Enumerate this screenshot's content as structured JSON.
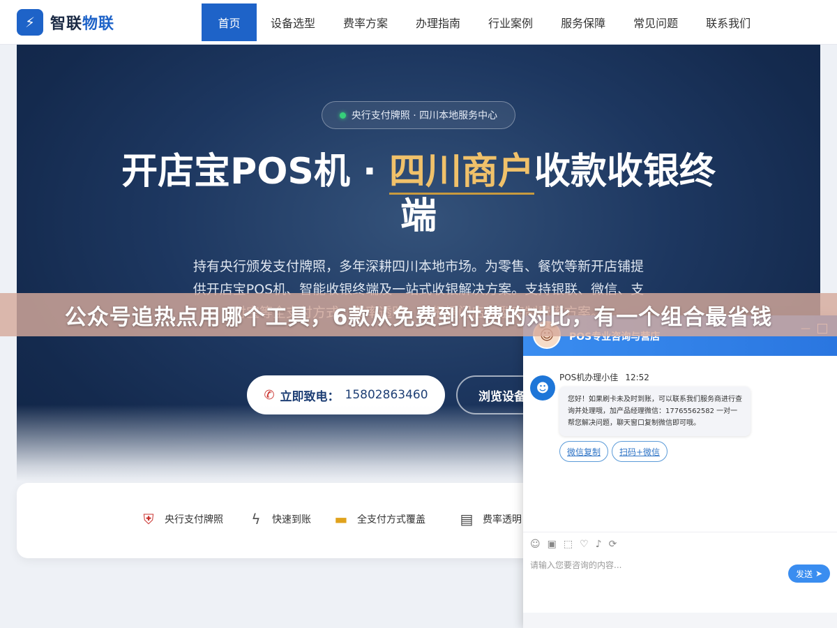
{
  "header": {
    "logo_mark": "⚡",
    "logo_main": "智联",
    "logo_accent": "物联",
    "nav": [
      "首页",
      "设备选型",
      "费率方案",
      "办理指南",
      "行业案例",
      "服务保障",
      "常见问题",
      "联系我们"
    ]
  },
  "hero": {
    "badge": "央行支付牌照 · 四川本地服务中心",
    "title_pre": "开店宝POS机 · ",
    "title_highlight": "四川商户",
    "title_post": "收款收银终端",
    "description": "持有央行颁发支付牌照，多年深耕四川本地市场。为零售、餐饮等新开店铺提供开店宝POS机、智能收银终端及一站式收银解决方案。支持银联、微信、支付宝等全支付方式，费率透明，可根据门店类型定制费率方案。",
    "cta_label": "立即致电：",
    "cta_phone": "15802863460",
    "cta_browse": "浏览设备"
  },
  "features": [
    {
      "icon": "shield-icon",
      "label": "央行支付牌照"
    },
    {
      "icon": "lightning-icon",
      "label": "快速到账"
    },
    {
      "icon": "card-icon",
      "label": "全支付方式覆盖"
    },
    {
      "icon": "clipboard-icon",
      "label": "费率透明"
    }
  ],
  "banner": {
    "text": "公众号追热点用哪个工具，6款从免费到付费的对比，有一个组合最省钱"
  },
  "chat": {
    "title": "POS专业咨询与营店",
    "agent_name": "POS机办理小佳",
    "time": "12:52",
    "message": "您好！如果刷卡未及时到账，可以联系我们服务商进行查询并处理哦，加产品经理微信：17765562582 一对一帮您解决问题，聊天窗口复制微信即可哦。",
    "quick_buttons": [
      "微信复制",
      "扫码+微信"
    ],
    "input_placeholder": "请输入您要咨询的内容...",
    "send_label": "发送"
  }
}
